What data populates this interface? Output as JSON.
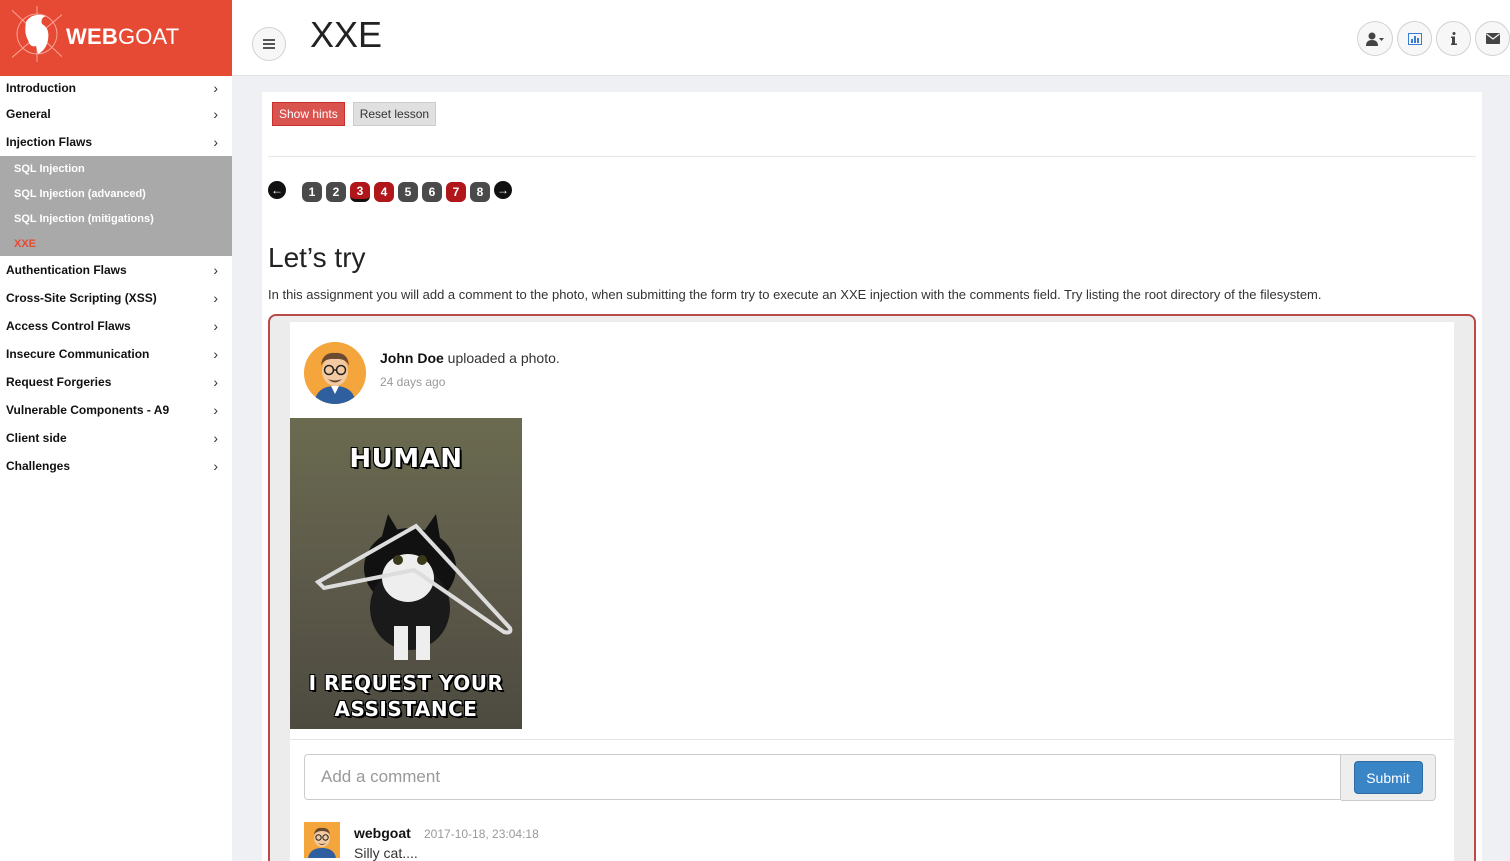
{
  "brand": {
    "name_bold": "WEB",
    "name_rest": "GOAT"
  },
  "sidebar": {
    "items": [
      {
        "label": "Introduction",
        "chevron": "›"
      },
      {
        "label": "General",
        "chevron": "›"
      },
      {
        "label": "Injection Flaws",
        "chevron": "›"
      },
      {
        "label": "Authentication Flaws",
        "chevron": "›"
      },
      {
        "label": "Cross-Site Scripting (XSS)",
        "chevron": "›"
      },
      {
        "label": "Access Control Flaws",
        "chevron": "›"
      },
      {
        "label": "Insecure Communication",
        "chevron": "›"
      },
      {
        "label": "Request Forgeries",
        "chevron": "›"
      },
      {
        "label": "Vulnerable Components - A9",
        "chevron": "›"
      },
      {
        "label": "Client side",
        "chevron": "›"
      },
      {
        "label": "Challenges",
        "chevron": "›"
      }
    ],
    "submenu": [
      {
        "label": "SQL Injection"
      },
      {
        "label": "SQL Injection (advanced)"
      },
      {
        "label": "SQL Injection (mitigations)"
      },
      {
        "label": "XXE",
        "active": true
      }
    ]
  },
  "header": {
    "title": "XXE",
    "menu_icon": "bars-icon",
    "icons": [
      "user-icon",
      "chart-icon",
      "info-icon",
      "envelope-icon"
    ]
  },
  "lesson": {
    "show_hints": "Show hints",
    "reset_lesson": "Reset lesson",
    "pages": [
      {
        "num": "1",
        "state": "default"
      },
      {
        "num": "2",
        "state": "default"
      },
      {
        "num": "3",
        "state": "current"
      },
      {
        "num": "4",
        "state": "red"
      },
      {
        "num": "5",
        "state": "default"
      },
      {
        "num": "6",
        "state": "default"
      },
      {
        "num": "7",
        "state": "red"
      },
      {
        "num": "8",
        "state": "default"
      }
    ],
    "heading": "Let’s try",
    "text": "In this assignment you will add a comment to the photo, when submitting the form try to execute an XXE injection with the comments field. Try listing the root directory of the filesystem."
  },
  "post": {
    "author": "John Doe",
    "action": " uploaded a photo.",
    "time": "24 days ago",
    "photo_caption_top": "HUMAN",
    "photo_caption_bottom_1": "I REQUEST YOUR",
    "photo_caption_bottom_2": "ASSISTANCE",
    "comment_placeholder": "Add a comment",
    "submit_label": "Submit",
    "comments": [
      {
        "author": "webgoat",
        "time": "2017-10-18, 23:04:18",
        "text": "Silly cat...."
      }
    ]
  },
  "colors": {
    "brand": "#e64a35",
    "danger": "#d9534f",
    "page_red": "#b0161a",
    "primary": "#3a85c6"
  }
}
